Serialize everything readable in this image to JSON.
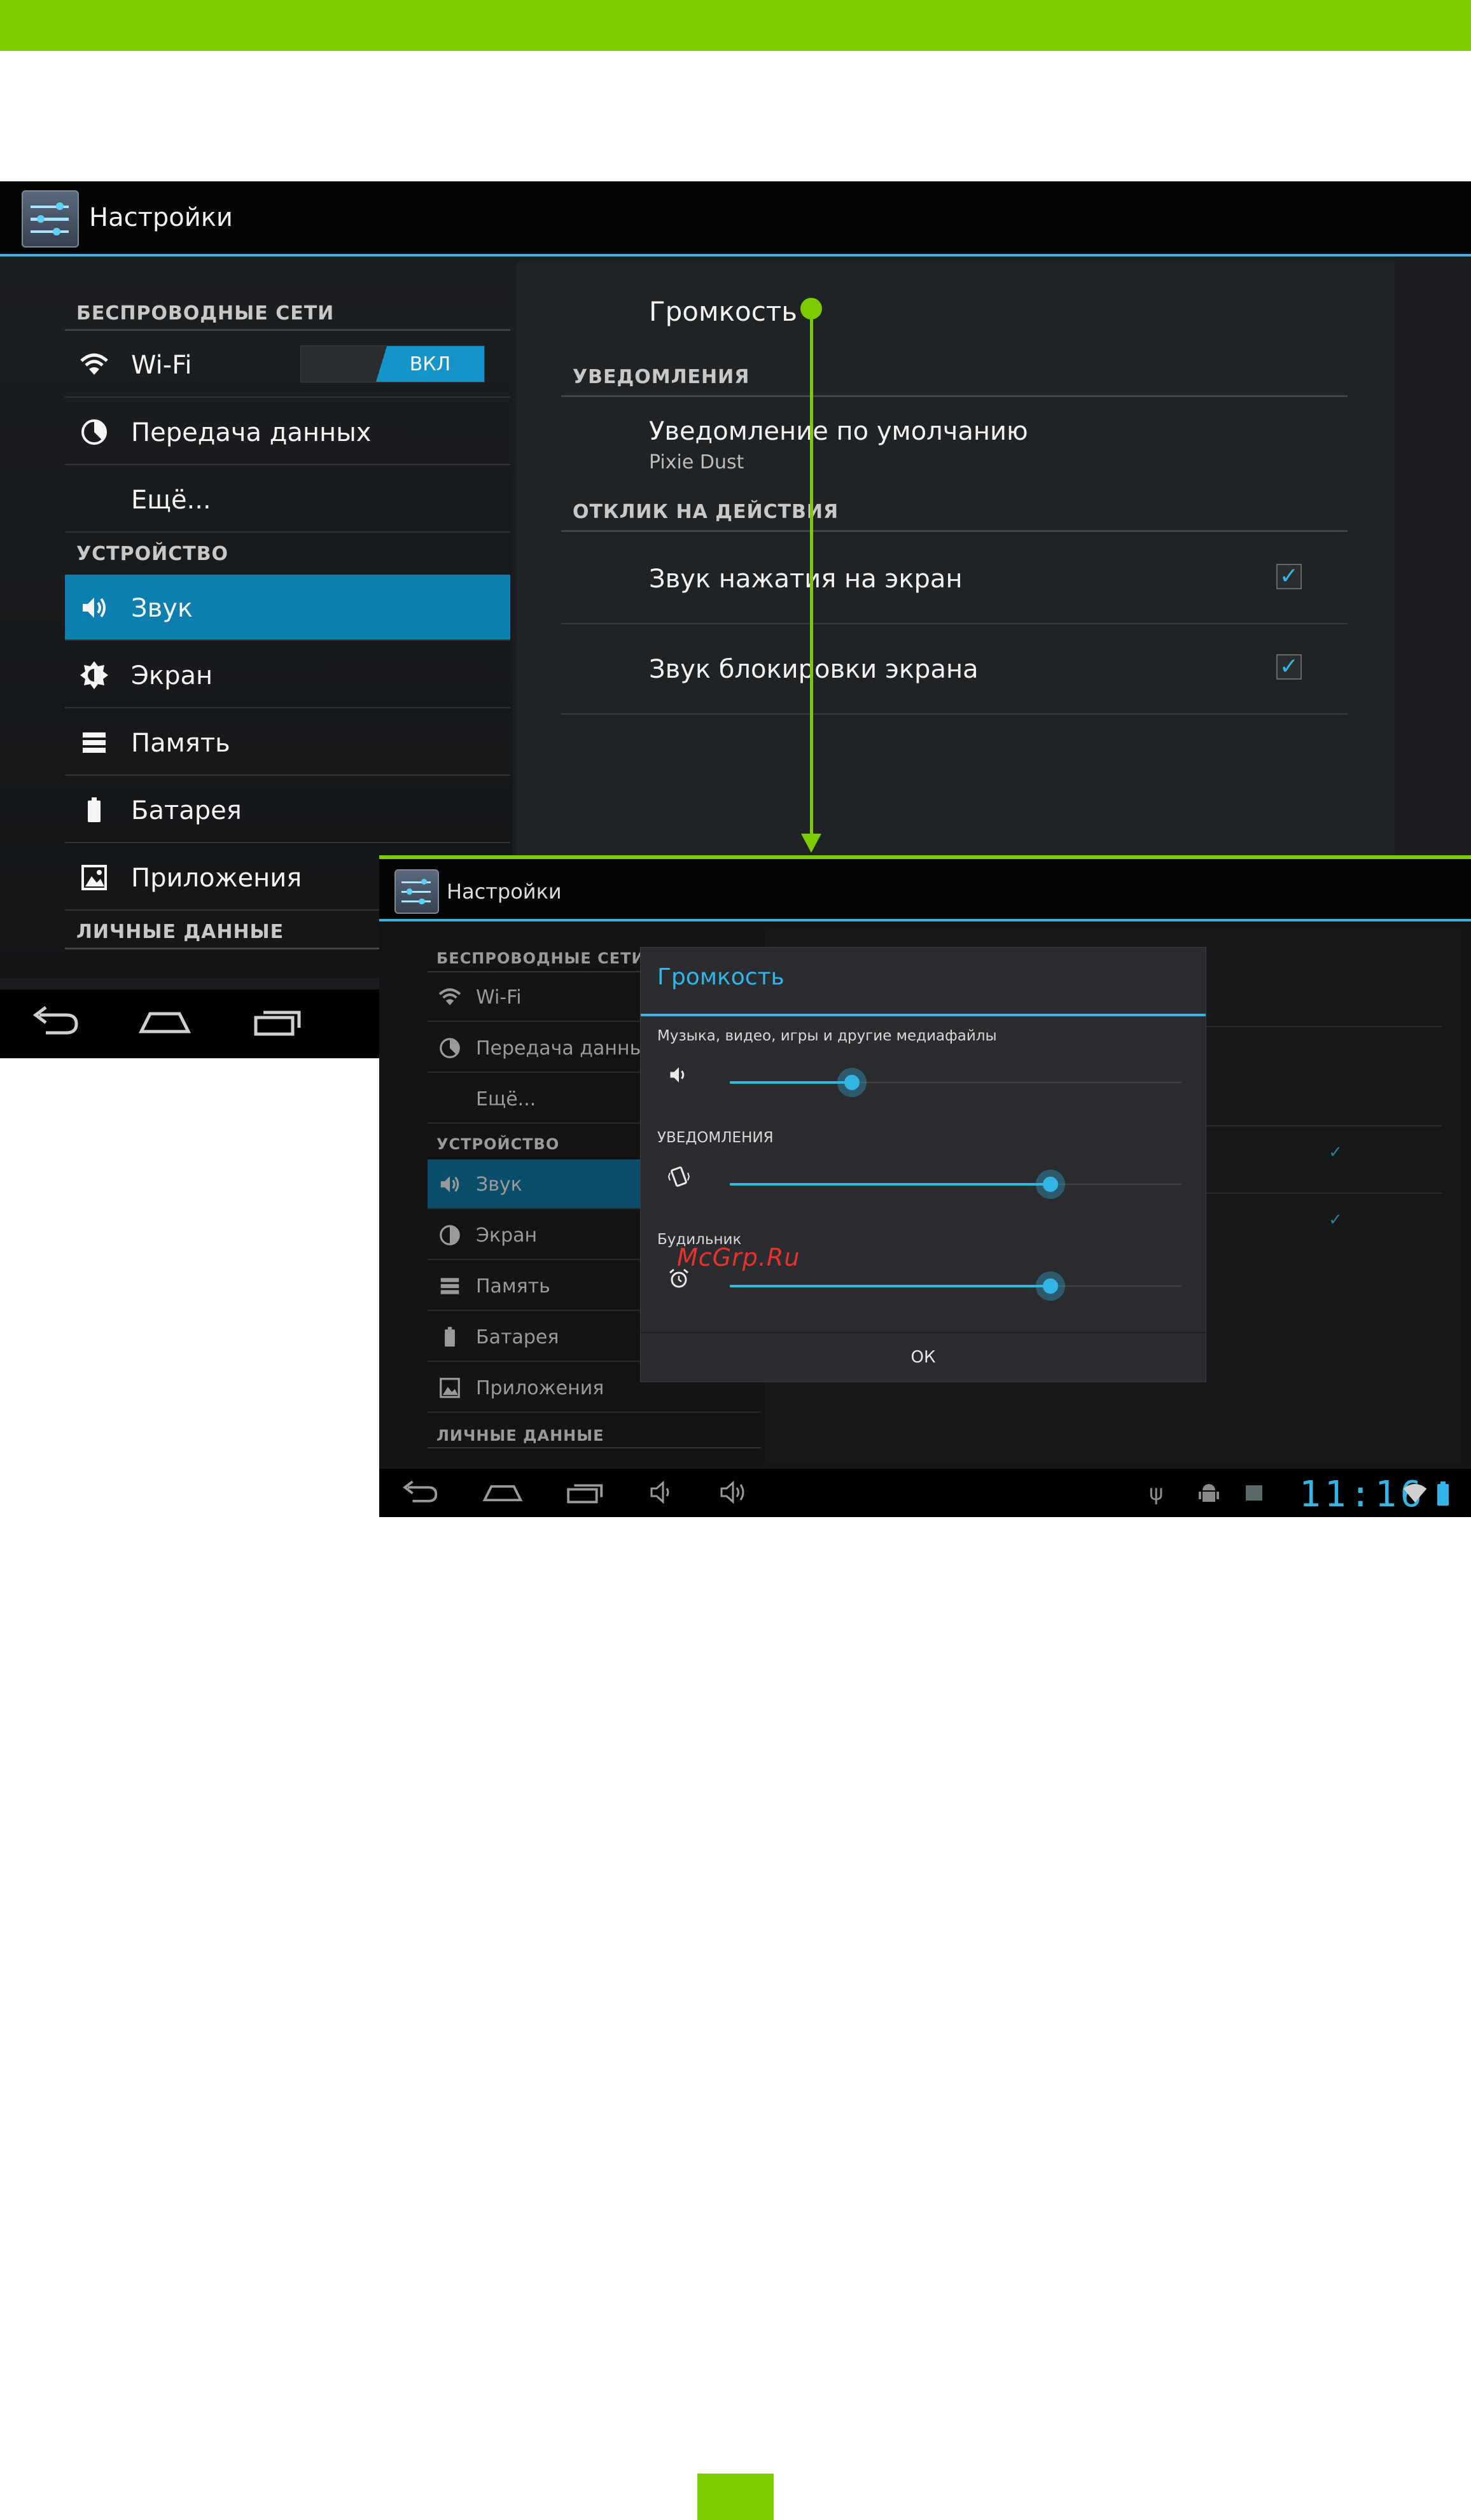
{
  "shot1": {
    "app_title": "Настройки",
    "sections": {
      "wireless": "БЕСПРОВОДНЫЕ СЕТИ",
      "device": "УСТРОЙСТВО",
      "personal": "ЛИЧНЫЕ ДАННЫЕ"
    },
    "items": {
      "wifi": "Wi-Fi",
      "wifi_toggle": "ВКЛ",
      "data": "Передача данных",
      "more": "Ещё...",
      "sound": "Звук",
      "screen": "Экран",
      "memory": "Память",
      "battery": "Батарея",
      "apps": "Приложения"
    },
    "right": {
      "volume": "Громкость",
      "notifications_header": "УВЕДОМЛЕНИЯ",
      "default_notification": "Уведомление по умолчанию",
      "default_notification_value": "Pixie Dust",
      "feedback_header": "ОТКЛИК НА ДЕЙСТВИЯ",
      "touch_sound": "Звук нажатия на экран",
      "lock_sound": "Звук блокировки экрана"
    }
  },
  "shot2": {
    "app_title": "Настройки",
    "sections": {
      "wireless": "БЕСПРОВОДНЫЕ СЕТИ",
      "device": "УСТРОЙСТВО",
      "personal": "ЛИЧНЫЕ ДАННЫЕ"
    },
    "items": {
      "wifi": "Wi-Fi",
      "data": "Передача данных",
      "more": "Ещё...",
      "sound": "Звук",
      "screen": "Экран",
      "memory": "Память",
      "battery": "Батарея",
      "apps": "Приложения"
    },
    "clock": "11:16",
    "dialog": {
      "title": "Громкость",
      "media_label": "Музыка, видео, игры и другие медиафайлы",
      "media_level": 0.27,
      "notif_label": "УВЕДОМЛЕНИЯ",
      "notif_level": 0.71,
      "alarm_label": "Будильник",
      "alarm_level": 0.71,
      "ok": "ОК"
    }
  },
  "watermark": "McGrp.Ru",
  "colors": {
    "accent_green": "#7ccc00",
    "holo_blue": "#33b5e5",
    "selected_item": "#0d7fae"
  }
}
